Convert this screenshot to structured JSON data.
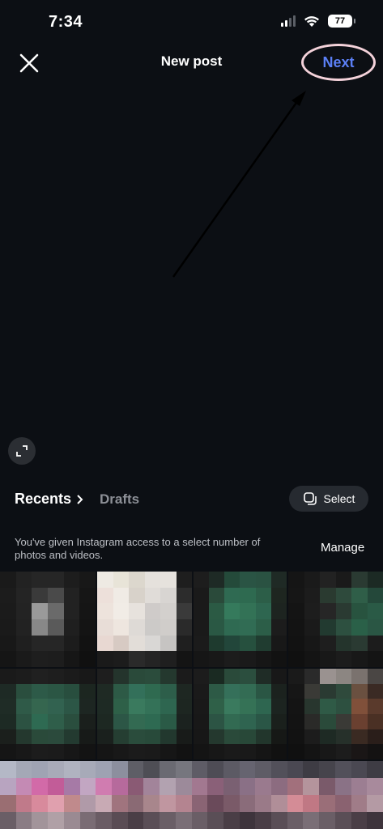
{
  "status_bar": {
    "time": "7:34",
    "battery": "77"
  },
  "header": {
    "title": "New post",
    "next_label": "Next"
  },
  "gallery": {
    "recents_label": "Recents",
    "drafts_label": "Drafts",
    "select_label": "Select",
    "access_notice": "You've given Instagram access to a select number of photos and videos.",
    "manage_label": "Manage"
  },
  "colors": {
    "accent": "#5b7ff5",
    "next_outline": "#f4d2da",
    "background": "#0c0f14"
  },
  "icons": [
    "close-icon",
    "expand-icon",
    "chevron-right-icon",
    "multi-select-icon",
    "wifi-icon",
    "signal-icon",
    "battery-icon"
  ]
}
